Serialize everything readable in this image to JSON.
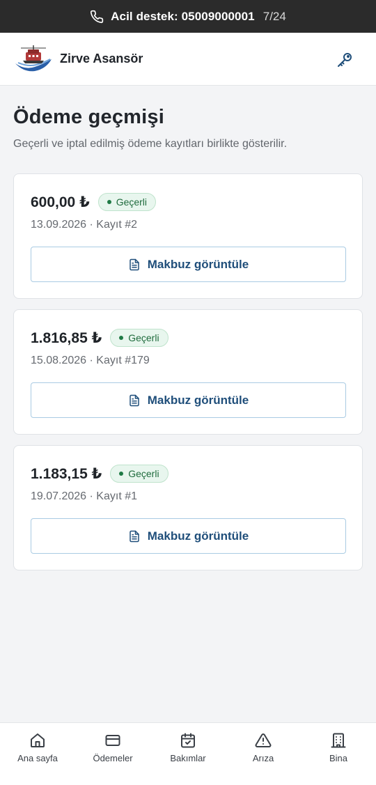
{
  "banner": {
    "label": "Acil destek: 05009000001",
    "counter": "7/24",
    "icon": "phone-icon"
  },
  "header": {
    "brand": "Zirve Asansör",
    "logo": "ship-logo",
    "action_icon": "key-icon"
  },
  "main": {
    "title": "Ödeme geçmişi",
    "subtitle": "Geçerli ve iptal edilmiş ödeme kayıtları birlikte gösterilir.",
    "payments": [
      {
        "amount": "600,00 ₺",
        "status": "Geçerli",
        "meta": "13.09.2026 · Kayıt #2",
        "button": "Makbuz görüntüle"
      },
      {
        "amount": "1.816,85 ₺",
        "status": "Geçerli",
        "meta": "15.08.2026 · Kayıt #179",
        "button": "Makbuz görüntüle"
      },
      {
        "amount": "1.183,15 ₺",
        "status": "Geçerli",
        "meta": "19.07.2026 · Kayıt #1",
        "button": "Makbuz görüntüle"
      }
    ]
  },
  "nav": {
    "items": [
      {
        "label": "Ana sayfa",
        "icon": "home-icon"
      },
      {
        "label": "Ödemeler",
        "icon": "credit-card-icon"
      },
      {
        "label": "Bakımlar",
        "icon": "calendar-check-icon"
      },
      {
        "label": "Arıza",
        "icon": "warning-icon"
      },
      {
        "label": "Bina",
        "icon": "building-icon"
      }
    ]
  },
  "colors": {
    "banner_bg": "#2b2b2b",
    "accent": "#1f4e7a",
    "status_ok": "#1f6b3d",
    "status_ok_bg": "#e8f6ee"
  }
}
